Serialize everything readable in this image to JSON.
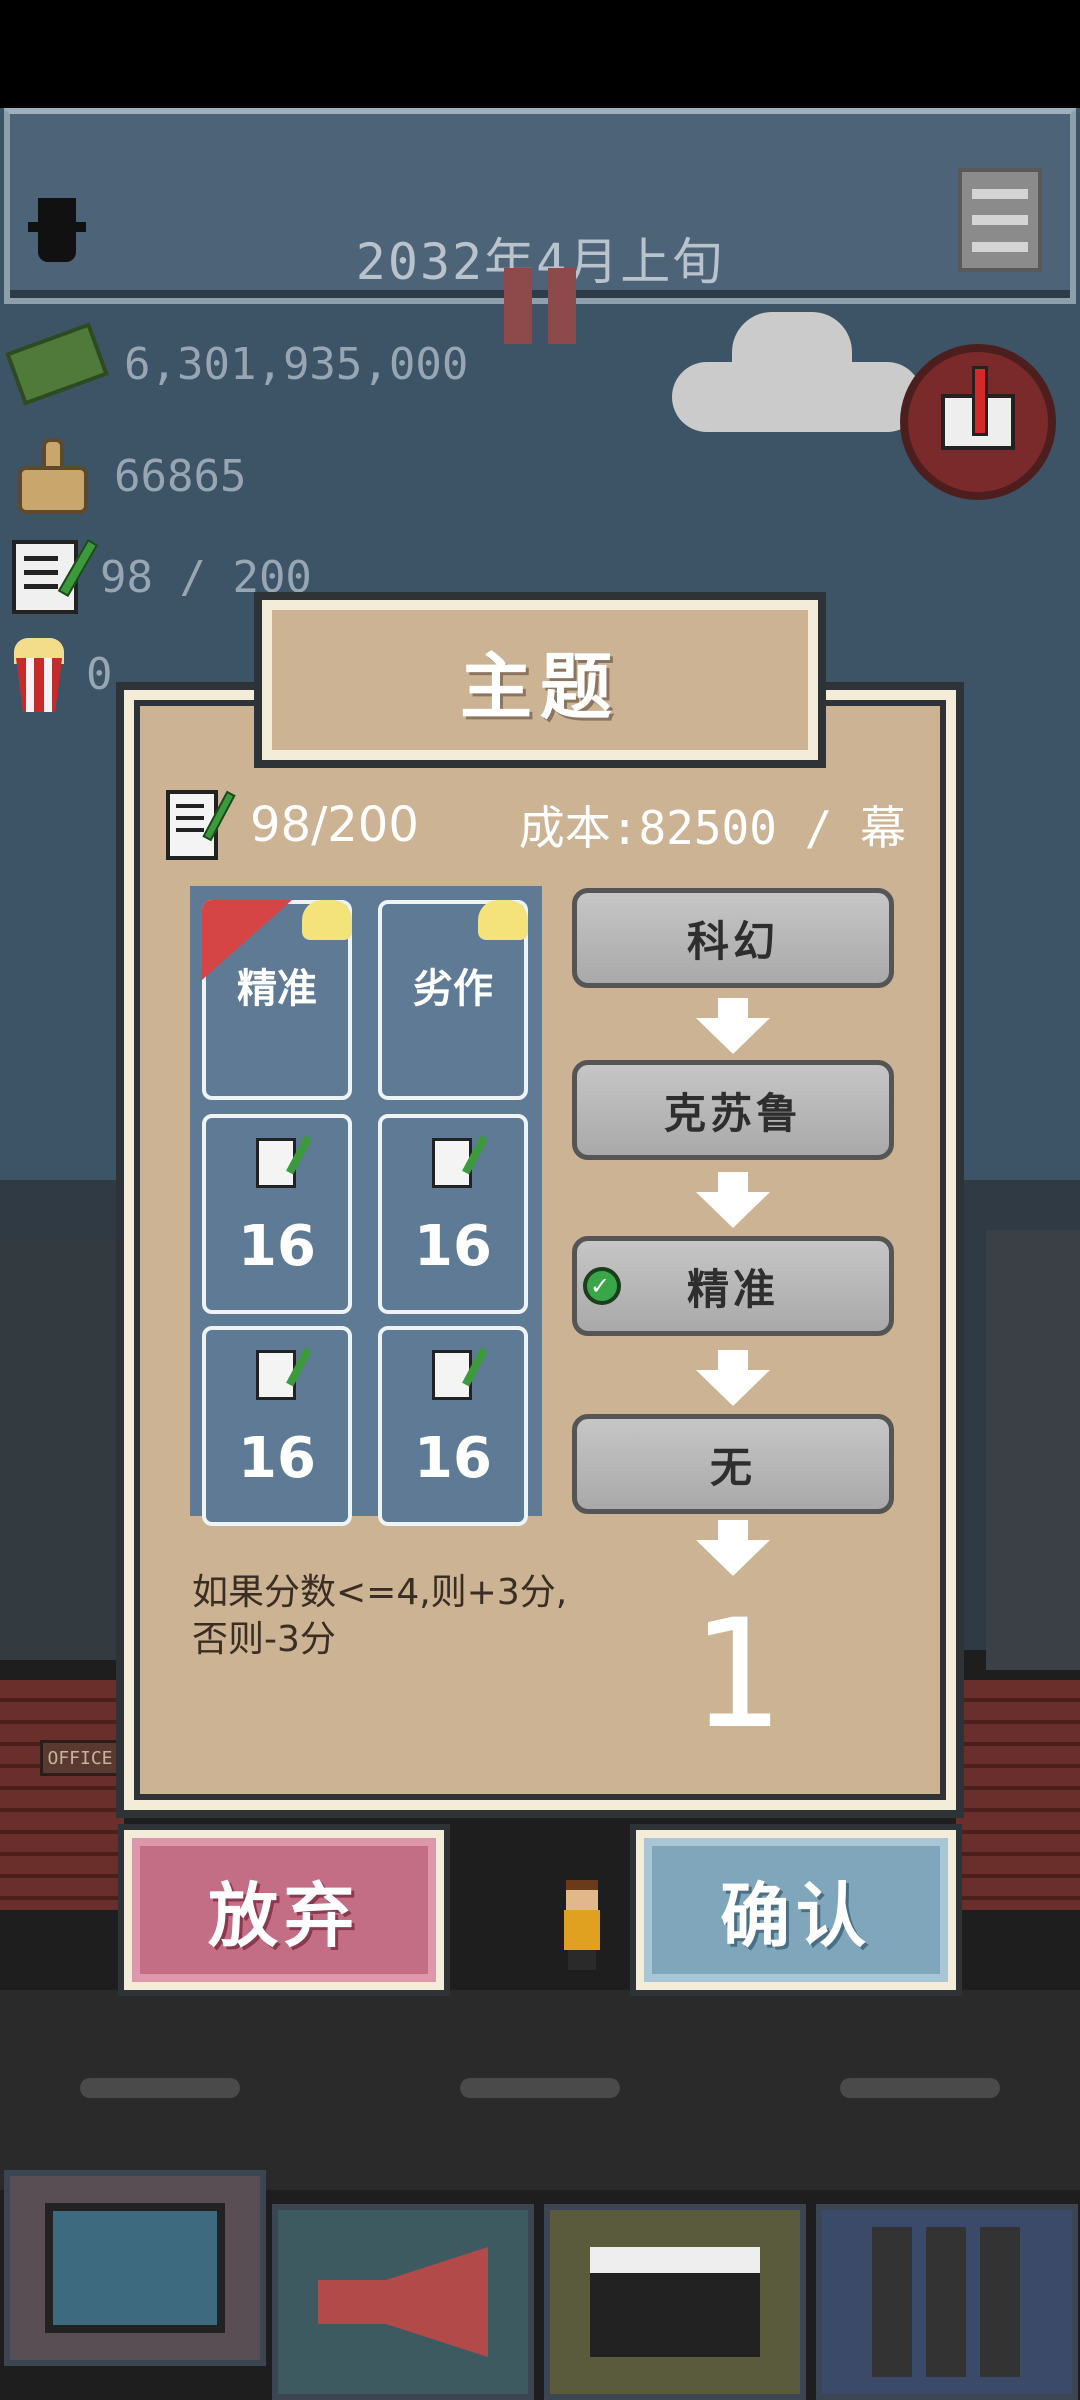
{
  "top_bar": {
    "date": "2032年4月上旬"
  },
  "stats": {
    "money": "6,301,935,000",
    "likes": "66865",
    "scripts": "98 / 200",
    "fans": "0"
  },
  "dialog": {
    "title": "主题",
    "progress": "98/200",
    "cost": "成本:82500 / 幕",
    "cards": [
      {
        "label": "精准"
      },
      {
        "label": "劣作"
      },
      {
        "value": "16"
      },
      {
        "value": "16"
      },
      {
        "value": "16"
      },
      {
        "value": "16"
      }
    ],
    "pipeline": [
      "科幻",
      "克苏鲁",
      "精准",
      "无"
    ],
    "rule": "如果分数<=4,则+3分,否则-3分",
    "result": "1"
  },
  "buttons": {
    "abandon": "放弃",
    "confirm": "确认"
  },
  "scenery": {
    "office_sign": "OFFICE"
  },
  "colors": {
    "dialog_bg": "#cbb394",
    "card_bg": "#5e7a94",
    "abandon": "#c46e86",
    "confirm": "#7fa6bb"
  }
}
